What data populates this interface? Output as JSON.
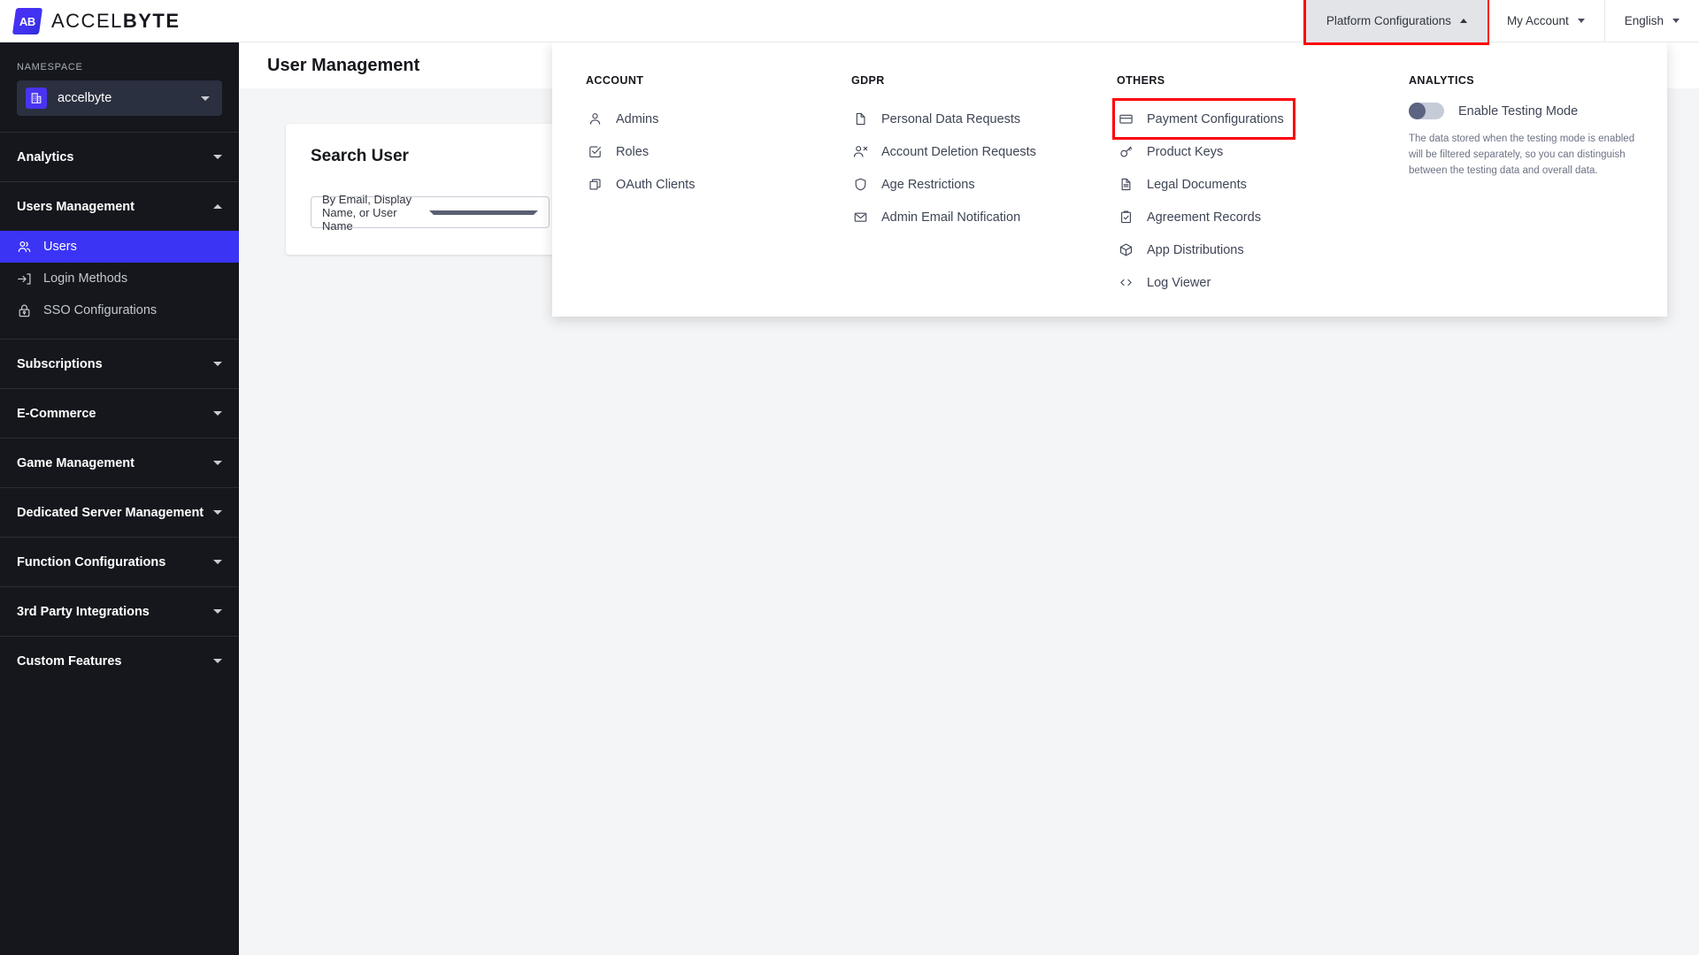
{
  "brand": {
    "logo_initials": "AB",
    "name_light": "ACCEL",
    "name_bold": "BYTE",
    "logo_icon": "accelbyte-logo-icon"
  },
  "topnav": {
    "items": [
      {
        "label": "Platform Configurations",
        "state": "open",
        "highlighted": true
      },
      {
        "label": "My Account",
        "state": "closed",
        "highlighted": false
      },
      {
        "label": "English",
        "state": "closed",
        "highlighted": false
      }
    ],
    "highlight_color": "#fb0007"
  },
  "sidebar": {
    "namespace_label": "NAMESPACE",
    "namespace_value": "accelbyte",
    "active_color": "#3b34f5",
    "groups": [
      {
        "label": "Analytics",
        "expanded": false,
        "items": []
      },
      {
        "label": "Users Management",
        "expanded": true,
        "items": [
          {
            "label": "Users",
            "icon": "users-icon",
            "selected": true
          },
          {
            "label": "Login Methods",
            "icon": "login-arrow-icon",
            "selected": false
          },
          {
            "label": "SSO Configurations",
            "icon": "lock-icon",
            "selected": false
          }
        ]
      },
      {
        "label": "Subscriptions",
        "expanded": false,
        "items": []
      },
      {
        "label": "E-Commerce",
        "expanded": false,
        "items": []
      },
      {
        "label": "Game Management",
        "expanded": false,
        "items": []
      },
      {
        "label": "Dedicated Server Management",
        "expanded": false,
        "items": []
      },
      {
        "label": "Function Configurations",
        "expanded": false,
        "items": []
      },
      {
        "label": "3rd Party Integrations",
        "expanded": false,
        "items": []
      },
      {
        "label": "Custom Features",
        "expanded": false,
        "items": []
      }
    ]
  },
  "main": {
    "page_title": "User Management",
    "card": {
      "title": "Search User",
      "search_select_value": "By Email, Display Name, or User Name"
    }
  },
  "mega_menu": {
    "columns": [
      {
        "heading": "ACCOUNT",
        "items": [
          {
            "label": "Admins",
            "icon": "person-icon",
            "highlighted": false
          },
          {
            "label": "Roles",
            "icon": "checkbox-icon",
            "highlighted": false
          },
          {
            "label": "OAuth Clients",
            "icon": "copy-icon",
            "highlighted": false
          }
        ]
      },
      {
        "heading": "GDPR",
        "items": [
          {
            "label": "Personal Data Requests",
            "icon": "file-icon",
            "highlighted": false
          },
          {
            "label": "Account Deletion Requests",
            "icon": "person-remove-icon",
            "highlighted": false
          },
          {
            "label": "Age Restrictions",
            "icon": "shield-icon",
            "highlighted": false
          },
          {
            "label": "Admin Email Notification",
            "icon": "envelope-icon",
            "highlighted": false
          }
        ]
      },
      {
        "heading": "OTHERS",
        "items": [
          {
            "label": "Payment Configurations",
            "icon": "credit-card-icon",
            "highlighted": true
          },
          {
            "label": "Product Keys",
            "icon": "key-icon",
            "highlighted": false
          },
          {
            "label": "Legal Documents",
            "icon": "document-text-icon",
            "highlighted": false
          },
          {
            "label": "Agreement Records",
            "icon": "clipboard-check-icon",
            "highlighted": false
          },
          {
            "label": "App Distributions",
            "icon": "package-icon",
            "highlighted": false
          },
          {
            "label": "Log Viewer",
            "icon": "code-brackets-icon",
            "highlighted": false
          }
        ]
      },
      {
        "heading": "ANALYTICS",
        "toggle": {
          "label": "Enable Testing Mode",
          "state": "off",
          "description": "The data stored when the testing mode is enabled will be filtered separately, so you can distinguish between the testing data and overall data."
        }
      }
    ]
  }
}
